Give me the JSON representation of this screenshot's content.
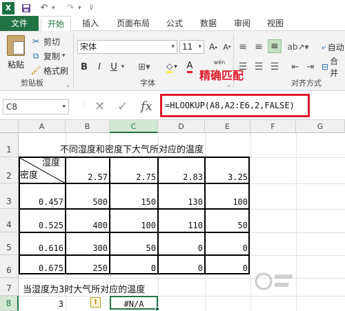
{
  "titlebar": {
    "logo_text": "X",
    "icons": [
      "excel-logo-icon",
      "save-icon",
      "undo-icon",
      "redo-icon"
    ]
  },
  "tabs": {
    "file": "文件",
    "home": "开始",
    "insert": "插入",
    "layout": "页面布局",
    "formulas": "公式",
    "data": "数据",
    "review": "审阅",
    "view": "视图"
  },
  "ribbon": {
    "clipboard": {
      "paste": "粘贴",
      "cut": "剪切",
      "copy": "复制",
      "format_painter": "格式刷",
      "group_label": "剪贴板"
    },
    "font": {
      "name": "宋体",
      "size": "11",
      "bold": "B",
      "italic": "I",
      "underline": "U",
      "phonetic": "wén",
      "font_color_icon": "A",
      "group_label": "字体"
    },
    "alignment": {
      "wrap_short": "自动",
      "merge_short": "合并",
      "group_label": "对齐方式"
    }
  },
  "annotation": "精确匹配",
  "formula_bar": {
    "name_box": "C8",
    "fx": "fx",
    "formula": "=HLOOKUP(A8,A2:E6,2,FALSE)"
  },
  "sheet": {
    "columns": [
      "A",
      "B",
      "C",
      "D",
      "E",
      "F",
      "G"
    ],
    "rows": [
      "1",
      "2",
      "3",
      "4",
      "5",
      "6",
      "7",
      "8"
    ],
    "title": "不同湿度和密度下大气所对应的温度",
    "header_top": "湿度",
    "header_bottom": "密度",
    "humidity": [
      "2.57",
      "2.75",
      "2.83",
      "3.25"
    ],
    "data_rows": [
      {
        "density": "0.457",
        "values": [
          "500",
          "150",
          "130",
          "100"
        ]
      },
      {
        "density": "0.525",
        "values": [
          "400",
          "100",
          "110",
          "50"
        ]
      },
      {
        "density": "0.616",
        "values": [
          "300",
          "50",
          "0",
          "0"
        ]
      },
      {
        "density": "0.675",
        "values": [
          "250",
          "0",
          "0",
          "0"
        ]
      }
    ],
    "row7_text": "当湿度为3时大气所对应的温度",
    "row8_input": "3",
    "row8_result": "#N/A",
    "warning_icon": "!"
  },
  "accent_color": "#217346",
  "highlight_color": "#e0182a"
}
